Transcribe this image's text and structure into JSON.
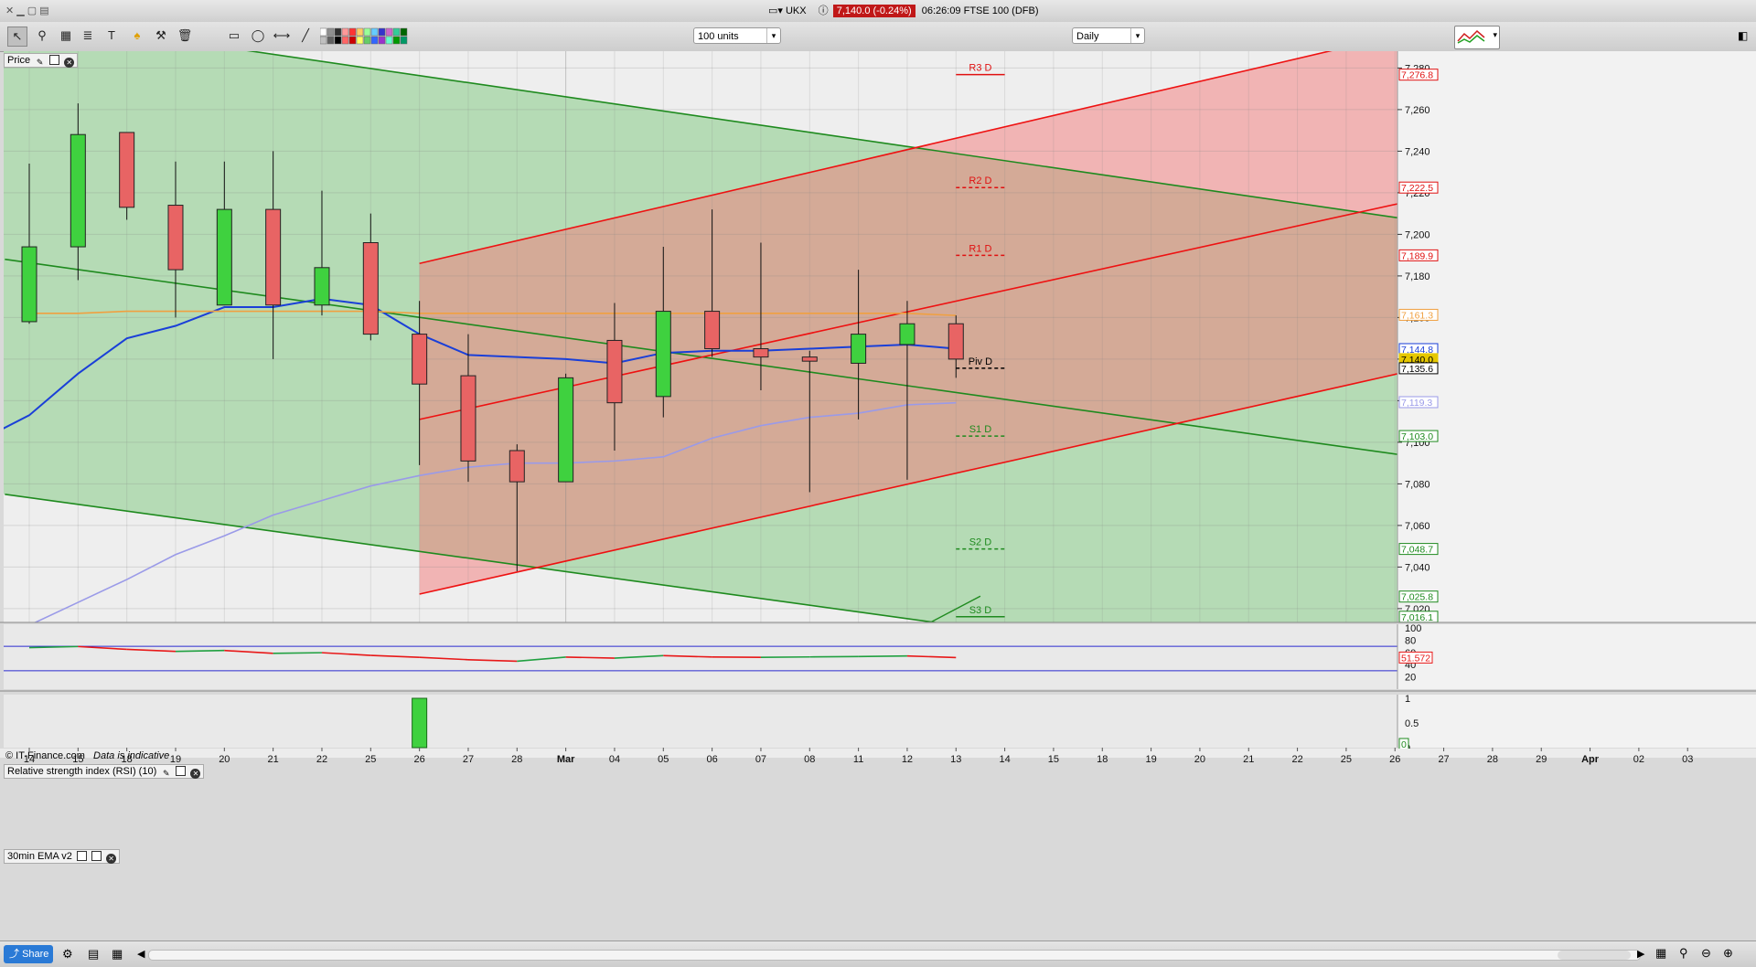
{
  "window": {
    "instrument_label": "UKX",
    "price_badge": "7,140.0 (-0.24%)",
    "title_rest": "06:26:09 FTSE 100 (DFB)"
  },
  "toolbar": {
    "units_select": "100 units",
    "period_select": "Daily"
  },
  "panels": {
    "price_label": "Price",
    "copyright": "© IT-Finance.com",
    "indicative": "Data is indicative",
    "rsi_label": "Relative strength index (RSI) (10)",
    "ema_label": "30min EMA v2"
  },
  "bottom": {
    "share_label": "Share"
  },
  "colors": {
    "bull": "#3fd13f",
    "bear": "#e86464",
    "channel_green": "#1e8a1e",
    "channel_red": "#ee1111",
    "ma_blue": "#1a3fd8",
    "ma_orange": "#f0a040",
    "ma_lavender": "#9a9ae8",
    "price_badge_bg": "#c01818"
  },
  "chart_data": {
    "type": "candlestick",
    "title": "",
    "x_labels": [
      "14",
      "15",
      "18",
      "19",
      "20",
      "21",
      "22",
      "25",
      "26",
      "27",
      "28",
      "Mar",
      "04",
      "05",
      "06",
      "07",
      "08",
      "11",
      "12",
      "13",
      "14",
      "15",
      "18",
      "19",
      "20",
      "21",
      "22",
      "25",
      "26",
      "27",
      "28",
      "29",
      "Apr",
      "02",
      "03"
    ],
    "ylim": [
      7010,
      7285
    ],
    "y_ticks": [
      7020,
      7040,
      7060,
      7080,
      7100,
      7120,
      7140,
      7160,
      7180,
      7200,
      7220,
      7240,
      7260,
      7280
    ],
    "y_tick_labels": [
      "7,020",
      "7,040",
      "7,060",
      "7,080",
      "7,100",
      "7,120",
      "7,140",
      "7,160",
      "7,180",
      "7,200",
      "7,220",
      "7,240",
      "7,260",
      "7,280"
    ],
    "candles": [
      {
        "x": "14",
        "open": 7158,
        "high": 7234,
        "low": 7157,
        "close": 7194
      },
      {
        "x": "15",
        "open": 7194,
        "high": 7263,
        "low": 7178,
        "close": 7248
      },
      {
        "x": "18",
        "open": 7249,
        "high": 7249,
        "low": 7207,
        "close": 7213
      },
      {
        "x": "19",
        "open": 7214,
        "high": 7235,
        "low": 7160,
        "close": 7183
      },
      {
        "x": "20",
        "open": 7166,
        "high": 7235,
        "low": 7166,
        "close": 7212
      },
      {
        "x": "21",
        "open": 7212,
        "high": 7240,
        "low": 7140,
        "close": 7166
      },
      {
        "x": "22",
        "open": 7166,
        "high": 7221,
        "low": 7161,
        "close": 7184
      },
      {
        "x": "25",
        "open": 7196,
        "high": 7210,
        "low": 7149,
        "close": 7152
      },
      {
        "x": "26",
        "open": 7152,
        "high": 7168,
        "low": 7089,
        "close": 7128
      },
      {
        "x": "27",
        "open": 7132,
        "high": 7152,
        "low": 7081,
        "close": 7091
      },
      {
        "x": "28",
        "open": 7096,
        "high": 7099,
        "low": 7038,
        "close": 7081
      },
      {
        "x": "Mar",
        "open": 7081,
        "high": 7133,
        "low": 7081,
        "close": 7131
      },
      {
        "x": "04",
        "open": 7149,
        "high": 7167,
        "low": 7096,
        "close": 7119
      },
      {
        "x": "05",
        "open": 7122,
        "high": 7194,
        "low": 7112,
        "close": 7163
      },
      {
        "x": "06",
        "open": 7163,
        "high": 7212,
        "low": 7141,
        "close": 7145
      },
      {
        "x": "07",
        "open": 7145,
        "high": 7196,
        "low": 7125,
        "close": 7141
      },
      {
        "x": "08",
        "open": 7141,
        "high": 7144,
        "low": 7076,
        "close": 7139
      },
      {
        "x": "11",
        "open": 7138,
        "high": 7183,
        "low": 7111,
        "close": 7152
      },
      {
        "x": "12",
        "open": 7147,
        "high": 7168,
        "low": 7082,
        "close": 7157
      },
      {
        "x": "13",
        "open": 7157,
        "high": 7161,
        "low": 7131,
        "close": 7140
      }
    ],
    "moving_averages": [
      {
        "color": "#1a3fd8",
        "values": [
          7101,
          7113,
          7133,
          7150,
          7156,
          7165,
          7165,
          7169,
          7166,
          7152,
          7142,
          7141,
          7140,
          7138,
          7143,
          7144,
          7144,
          7145,
          7146,
          7147,
          7145
        ]
      },
      {
        "color": "#f0a040",
        "values": [
          7162,
          7162,
          7163,
          7163,
          7163,
          7163,
          7163,
          7163,
          7162,
          7162,
          7162,
          7162,
          7162,
          7162,
          7162,
          7162,
          7162,
          7162,
          7162,
          7161
        ]
      },
      {
        "color": "#9a9ae8",
        "values": [
          7012,
          7023,
          7034,
          7046,
          7055,
          7065,
          7072,
          7079,
          7084,
          7088,
          7090,
          7090,
          7091,
          7093,
          7102,
          7108,
          7112,
          7114,
          7118,
          7119
        ]
      }
    ],
    "pivots": [
      {
        "label": "R3 D",
        "value": 7276.8,
        "color": "#e01010"
      },
      {
        "label": "R2 D",
        "value": 7222.5,
        "color": "#e01010"
      },
      {
        "label": "R1 D",
        "value": 7189.9,
        "color": "#e01010"
      },
      {
        "label": "Piv D",
        "value": 7135.6,
        "color": "#000000"
      },
      {
        "label": "S1 D",
        "value": 7103.0,
        "color": "#1e8a1e"
      },
      {
        "label": "S2 D",
        "value": 7048.7,
        "color": "#1e8a1e"
      },
      {
        "label": "S3 D",
        "value": 7016.1,
        "color": "#1e8a1e"
      }
    ],
    "right_axis_badges": [
      {
        "label": "7,276.8",
        "value": 7276.8,
        "color": "#e01010"
      },
      {
        "label": "7,222.5",
        "value": 7222.5,
        "color": "#e01010"
      },
      {
        "label": "7,189.9",
        "value": 7189.9,
        "color": "#e01010"
      },
      {
        "label": "7,161.3",
        "value": 7161.3,
        "color": "#f0a040"
      },
      {
        "label": "7,144.8",
        "value": 7144.8,
        "color": "#1a3fd8"
      },
      {
        "label": "7,140.0",
        "value": 7140.0,
        "color": "#e6c800"
      },
      {
        "label": "7,135.6",
        "value": 7135.6,
        "color": "#000000"
      },
      {
        "label": "7,119.3",
        "value": 7119.3,
        "color": "#9a9ae8"
      },
      {
        "label": "7,103.0",
        "value": 7103.0,
        "color": "#1e8a1e"
      },
      {
        "label": "7,048.7",
        "value": 7048.7,
        "color": "#1e8a1e"
      },
      {
        "label": "7,025.8",
        "value": 7025.8,
        "color": "#1e8a1e"
      },
      {
        "label": "7,016.1",
        "value": 7016.1,
        "color": "#1e8a1e"
      }
    ],
    "channels": [
      {
        "color": "#1e8a1e",
        "from": {
          "i": 4,
          "v": 7290
        },
        "to": {
          "i": 34.5,
          "v": 7186
        }
      },
      {
        "color": "#1e8a1e",
        "from": {
          "i": -0.5,
          "v": 7188
        },
        "to": {
          "i": 34.5,
          "v": 7073
        }
      },
      {
        "color": "#1e8a1e",
        "from": {
          "i": -0.5,
          "v": 7075
        },
        "to": {
          "i": 19.6,
          "v": 7010
        }
      },
      {
        "color": "#ee1111",
        "from": {
          "i": 8,
          "v": 7186
        },
        "to": {
          "i": 27,
          "v": 7290
        }
      },
      {
        "color": "#ee1111",
        "from": {
          "i": 8,
          "v": 7111
        },
        "to": {
          "i": 34.5,
          "v": 7248
        }
      },
      {
        "color": "#ee1111",
        "from": {
          "i": 8,
          "v": 7027
        },
        "to": {
          "i": 34.5,
          "v": 7167
        }
      }
    ],
    "rsi": {
      "ylim": [
        0,
        100
      ],
      "y_ticks": [
        20,
        40,
        60,
        80,
        100
      ],
      "levels": [
        30,
        70
      ],
      "current_label": "51.572",
      "values": [
        67.8,
        69.6,
        65.0,
        61.7,
        63.1,
        58.5,
        59.5,
        55.2,
        51.9,
        48.1,
        45.6,
        52.4,
        50.6,
        54.7,
        52.5,
        52.0,
        52.6,
        53.2,
        54.2,
        51.6
      ]
    },
    "ema30": {
      "y_ticks_labels": [
        "1",
        "0.5",
        "0"
      ],
      "current_label": "0",
      "bars": [
        0,
        0,
        0,
        0,
        0,
        0,
        0,
        0,
        1,
        0,
        0,
        0,
        0,
        0,
        0,
        0,
        0,
        0,
        0,
        0
      ]
    }
  }
}
